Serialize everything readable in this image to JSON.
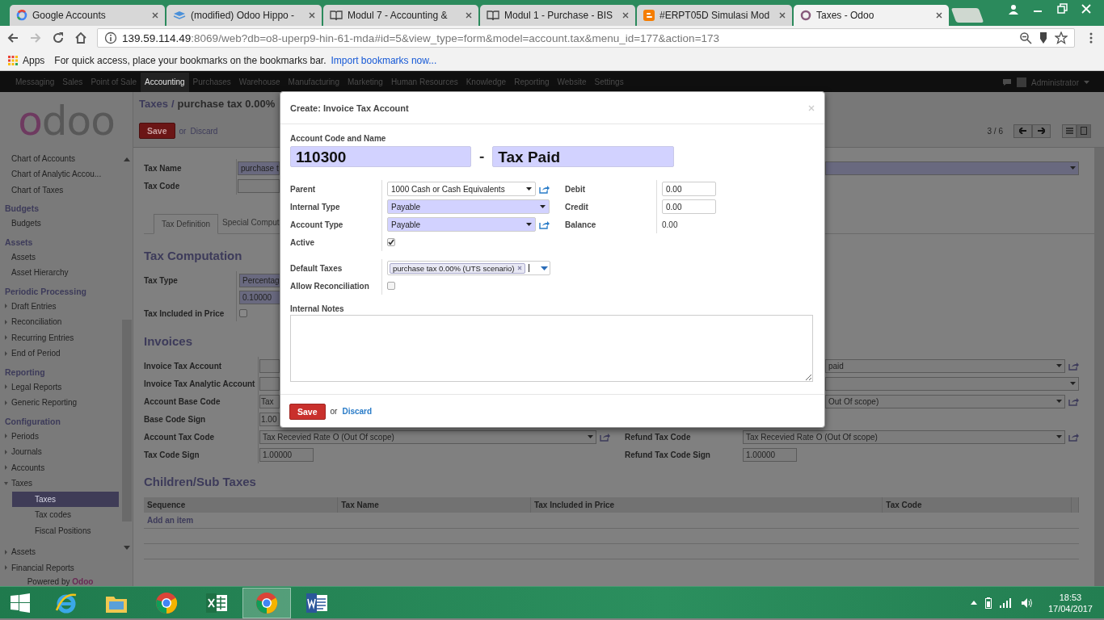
{
  "browser": {
    "tabs": [
      {
        "title": "Google Accounts",
        "kind": "google",
        "selected": false
      },
      {
        "title": "(modified) Odoo Hippo -",
        "kind": "layers",
        "selected": false
      },
      {
        "title": "Modul 7 - Accounting &",
        "kind": "book",
        "selected": false
      },
      {
        "title": "Modul 1 - Purchase - BIS",
        "kind": "book",
        "selected": false
      },
      {
        "title": "#ERPT05D Simulasi Mod",
        "kind": "blog",
        "selected": false
      },
      {
        "title": "Taxes - Odoo",
        "kind": "ring",
        "selected": true
      }
    ],
    "address": {
      "host": "139.59.114.49",
      "rest": ":8069/web?db=o8-uperp9-hin-61-mda#id=5&view_type=form&model=account.tax&menu_id=177&action=173"
    },
    "bookmarks": {
      "apps": "Apps",
      "hint": "For quick access, place your bookmarks on the bookmarks bar.",
      "link": "Import bookmarks now..."
    }
  },
  "top_menu": {
    "items": [
      {
        "label": "Messaging",
        "selected": false
      },
      {
        "label": "Sales",
        "selected": false
      },
      {
        "label": "Point of Sale",
        "selected": false
      },
      {
        "label": "Accounting",
        "selected": true
      },
      {
        "label": "Purchases",
        "selected": false
      },
      {
        "label": "Warehouse",
        "selected": false
      },
      {
        "label": "Manufacturing",
        "selected": false
      },
      {
        "label": "Marketing",
        "selected": false
      },
      {
        "label": "Human Resources",
        "selected": false
      },
      {
        "label": "Knowledge",
        "selected": false
      },
      {
        "label": "Reporting",
        "selected": false
      },
      {
        "label": "Website",
        "selected": false
      },
      {
        "label": "Settings",
        "selected": false
      }
    ],
    "user": "Administrator"
  },
  "sidebar": {
    "logo": "odoo",
    "sections": [
      {
        "items": [
          {
            "label": "Chart of Accounts",
            "selected": false
          },
          {
            "label": "Chart of Analytic Accou...",
            "selected": false
          },
          {
            "label": "Chart of Taxes",
            "selected": false
          }
        ]
      },
      {
        "heading": "Budgets",
        "items": [
          {
            "label": "Budgets",
            "selected": false
          }
        ]
      },
      {
        "heading": "Assets",
        "items": [
          {
            "label": "Assets",
            "selected": false
          },
          {
            "label": "Asset Hierarchy",
            "selected": false
          }
        ]
      },
      {
        "heading": "Periodic Processing",
        "items": [
          {
            "label": "Draft Entries",
            "expanded": false,
            "selected": false
          },
          {
            "label": "Reconciliation",
            "expanded": false,
            "selected": false
          },
          {
            "label": "Recurring Entries",
            "expanded": false,
            "selected": false
          },
          {
            "label": "End of Period",
            "expanded": false,
            "selected": false
          }
        ]
      },
      {
        "heading": "Reporting",
        "items": [
          {
            "label": "Legal Reports",
            "expanded": false,
            "selected": false
          },
          {
            "label": "Generic Reporting",
            "expanded": false,
            "selected": false
          }
        ]
      },
      {
        "heading": "Configuration",
        "items": [
          {
            "label": "Periods",
            "expanded": false,
            "selected": false
          },
          {
            "label": "Journals",
            "expanded": false,
            "selected": false
          },
          {
            "label": "Accounts",
            "expanded": false,
            "selected": false
          },
          {
            "label": "Taxes",
            "expanded": true,
            "selected": false,
            "children": [
              {
                "label": "Taxes",
                "selected": true
              },
              {
                "label": "Tax codes",
                "selected": false
              },
              {
                "label": "Fiscal Positions",
                "selected": false
              }
            ]
          },
          {
            "label": "Assets",
            "expanded": false,
            "selected": false
          },
          {
            "label": "Financial Reports",
            "expanded": false,
            "selected": false
          }
        ]
      }
    ],
    "footer": "Powered by **Odoo**"
  },
  "form": {
    "breadcrumb": {
      "parent": "Taxes",
      "separator": "/",
      "current": "purchase tax 0.00%"
    },
    "buttons": {
      "save": "Save",
      "or": "or",
      "discard": "Discard"
    },
    "pager": "3 / 6",
    "main_fields": [
      {
        "label": "Tax Name",
        "value": "purchase t",
        "required": true,
        "right": {
          "kind": "select",
          "required": true
        }
      },
      {
        "label": "Tax Code",
        "required": false
      }
    ],
    "tabs": [
      {
        "label": "Tax Definition",
        "selected": true
      },
      {
        "label": "Special Comput",
        "selected": false
      }
    ],
    "computation": {
      "title": "Tax Computation",
      "rows": [
        {
          "label": "Tax Type",
          "kind": "field",
          "value": "Percentag",
          "required": true
        },
        {
          "kind": "field",
          "value": "0.10000",
          "required": true
        },
        {
          "label": "Tax Included in Price",
          "kind": "checkbox",
          "checked": false
        }
      ]
    },
    "invoices": {
      "title": "Invoices",
      "rows": [
        {
          "label": "Invoice Tax Account",
          "left": {
            "kind": "field"
          },
          "right": {
            "kind": "select",
            "value": "paid",
            "link": true
          }
        },
        {
          "label": "Invoice Tax Analytic Account",
          "left": {
            "kind": "field"
          },
          "right": {
            "kind": "select"
          }
        },
        {
          "label": "Account Base Code",
          "left": {
            "kind": "field",
            "value": "Tax"
          },
          "right": {
            "kind": "select",
            "value": "Out Of scope)",
            "link": true
          }
        },
        {
          "label": "Base Code Sign",
          "left": {
            "kind": "field",
            "value": "1.00"
          }
        },
        {
          "label": "Account Tax Code",
          "left": {
            "kind": "select",
            "value": "Tax Recevied Rate O (Out Of scope)",
            "link": true
          },
          "right": {
            "label": "Refund Tax Code",
            "kind": "select",
            "value": "Tax Recevied Rate O (Out Of scope)",
            "link": true
          }
        },
        {
          "label": "Tax Code Sign",
          "left": {
            "kind": "short",
            "value": "1.00000"
          },
          "right": {
            "label": "Refund Tax Code Sign",
            "kind": "short",
            "value": "1.00000"
          }
        }
      ]
    },
    "children": {
      "title": "Children/Sub Taxes",
      "columns": [
        "Sequence",
        "Tax Name",
        "Tax Included in Price",
        "Tax Code"
      ],
      "add_item": "Add an item"
    }
  },
  "dialog": {
    "title": "Create: Invoice Tax Account",
    "heading": "Account Code and Name",
    "code": "110300",
    "separator": "-",
    "name": "Tax Paid",
    "left_rows": [
      {
        "label": "Parent",
        "kind": "select",
        "value": "1000 Cash or Cash Equivalents",
        "required": false,
        "link": true
      },
      {
        "label": "Internal Type",
        "kind": "select",
        "value": "Payable",
        "required": true,
        "link": false
      },
      {
        "label": "Account Type",
        "kind": "select",
        "value": "Payable",
        "required": true,
        "link": true
      },
      {
        "label": "Active",
        "kind": "checkbox",
        "checked": true
      }
    ],
    "right_rows": [
      {
        "label": "Debit",
        "kind": "input",
        "value": "0.00"
      },
      {
        "label": "Credit",
        "kind": "input",
        "value": "0.00"
      },
      {
        "label": "Balance",
        "kind": "readonly",
        "value": "0.00"
      }
    ],
    "lower_rows": [
      {
        "label": "Default Taxes",
        "kind": "tags",
        "tags": [
          "purchase tax 0.00% (UTS scenario)"
        ]
      },
      {
        "label": "Allow Reconciliation",
        "kind": "checkbox",
        "checked": false
      }
    ],
    "notes_label": "Internal Notes",
    "save": "Save",
    "or": "or",
    "discard": "Discard"
  },
  "taskbar": {
    "apps": [
      {
        "kind": "ie",
        "selected": false
      },
      {
        "kind": "files",
        "selected": false
      },
      {
        "kind": "chrome",
        "selected": false
      },
      {
        "kind": "excel",
        "selected": false
      },
      {
        "kind": "chrome",
        "selected": true
      },
      {
        "kind": "word",
        "selected": false
      }
    ],
    "time": "18:53",
    "date": "17/04/2017"
  }
}
